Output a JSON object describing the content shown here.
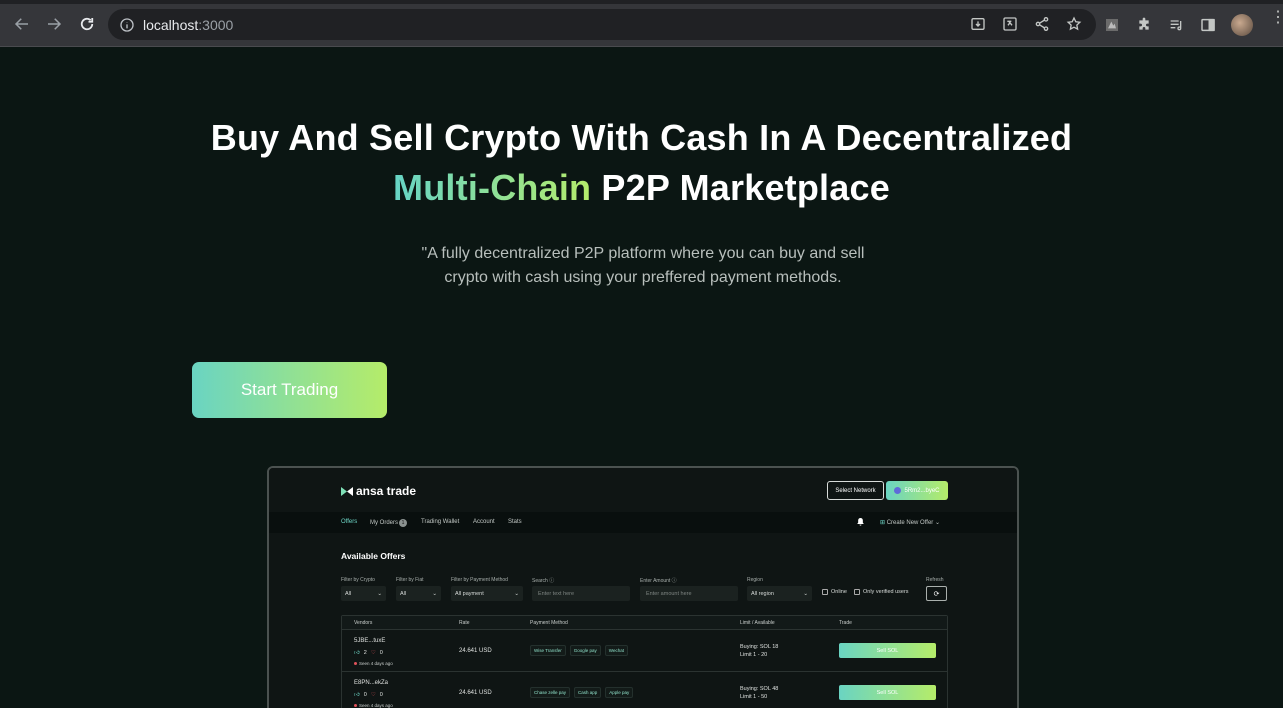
{
  "browser": {
    "url_host": "localhost",
    "url_port": ":3000"
  },
  "hero": {
    "title_line1": "Buy And Sell Crypto With Cash In A Decentralized",
    "title_highlight": "Multi-Chain",
    "title_line2_rest": " P2P Marketplace",
    "subtitle": "\"A fully decentralized P2P platform where you can buy and sell crypto with cash using your preffered payment methods.",
    "cta_label": "Start Trading"
  },
  "preview": {
    "logo_text": "ansa trade",
    "select_network": "Select Network",
    "wallet_label": "5Rm2...byeC",
    "nav": [
      {
        "label": "Offers"
      },
      {
        "label": "My Orders"
      },
      {
        "label": "Trading Wallet"
      },
      {
        "label": "Account"
      },
      {
        "label": "Stats"
      }
    ],
    "orders_badge": "1",
    "create_offer": "Create New Offer",
    "section_title": "Available Offers",
    "filters": {
      "crypto_label": "Filter by Crypto",
      "crypto_value": "All",
      "fiat_label": "Filter by Fiat",
      "fiat_value": "All",
      "payment_label": "Filter by Payment Method",
      "payment_value": "All payment",
      "search_label": "Search",
      "search_placeholder": "Enter text here",
      "amount_label": "Enter Amount",
      "amount_placeholder": "Enter amount here",
      "region_label": "Region",
      "region_value": "All region",
      "online_label": "Online",
      "verified_label": "Only verified users",
      "refresh_label": "Refresh"
    },
    "table": {
      "headers": [
        "Vendors",
        "Rate",
        "Payment Method",
        "Limit / Available",
        "Trade"
      ],
      "rows": [
        {
          "vendor": "5JBE...tuxE",
          "up": "2",
          "down": "0",
          "seen": "Seen 4 days ago",
          "rate": "24.641 USD",
          "payments": [
            "Wise Transfer",
            "Google pay",
            "Wechat"
          ],
          "buying": "Buying: SOL 18",
          "limit": "Limit     1 - 20",
          "action": "Sell SOL"
        },
        {
          "vendor": "E8PN...ekZa",
          "up": "0",
          "down": "0",
          "seen": "Seen 4 days ago",
          "rate": "24.641 USD",
          "payments": [
            "Chase zelle pay",
            "Cash app",
            "Apple pay"
          ],
          "buying": "Buying: SOL 48",
          "limit": "Limit     1 - 50",
          "action": "Sell SOL"
        }
      ]
    }
  }
}
